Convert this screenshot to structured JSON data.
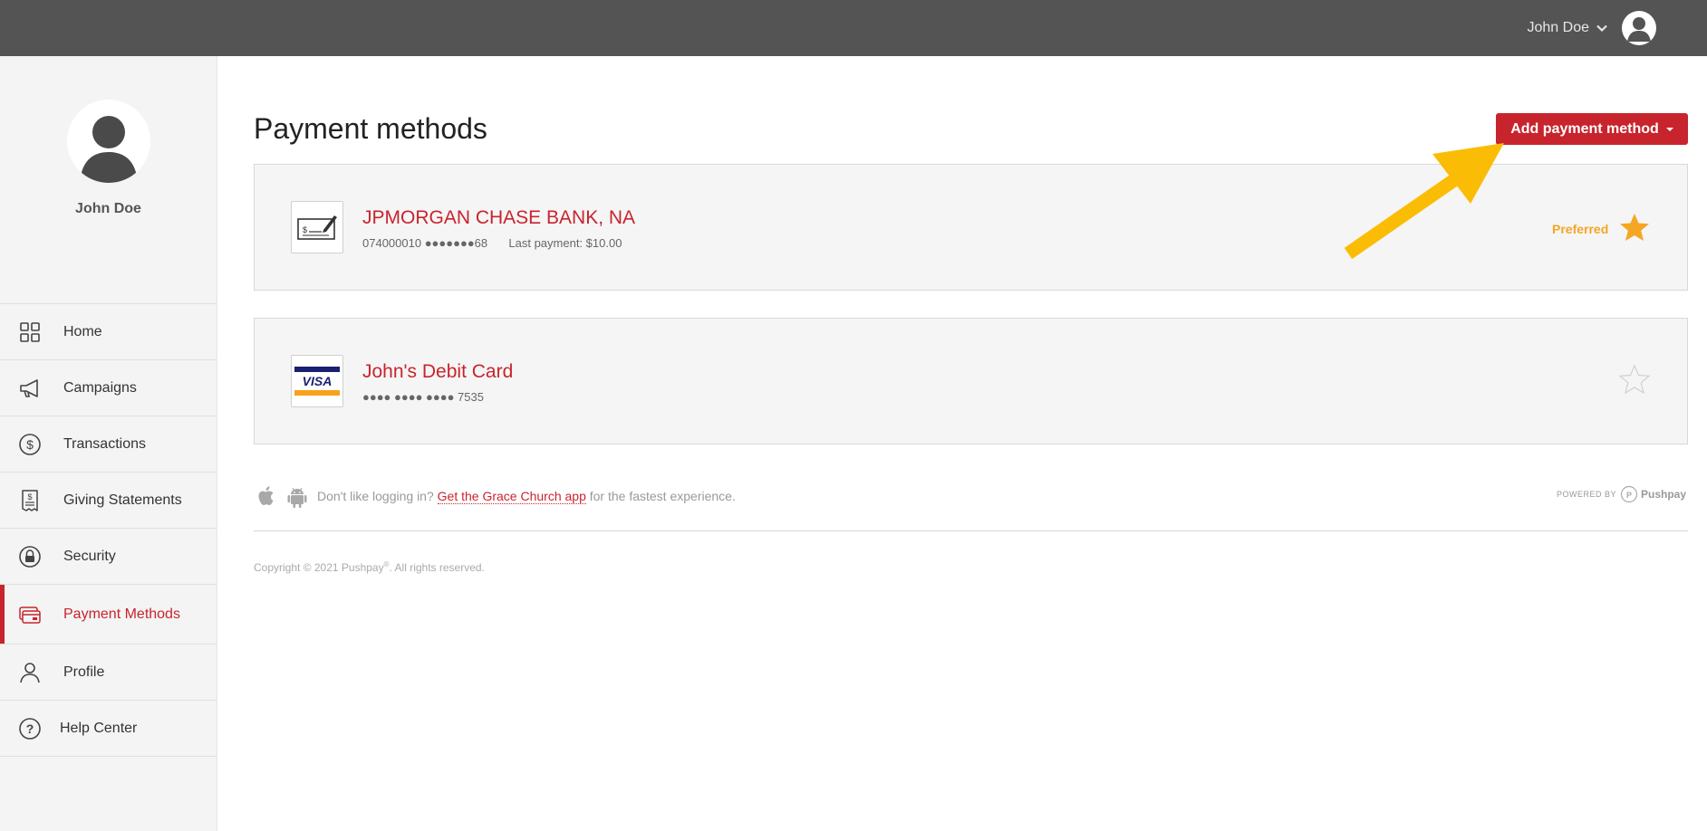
{
  "header": {
    "user_name": "John Doe",
    "icons": {
      "dropdown": "chevron-down-icon",
      "avatar": "user-avatar-icon"
    }
  },
  "sidebar": {
    "profile_name": "John Doe",
    "items": [
      {
        "id": "home",
        "label": "Home",
        "icon": "grid-icon",
        "active": false
      },
      {
        "id": "campaigns",
        "label": "Campaigns",
        "icon": "megaphone-icon",
        "active": false
      },
      {
        "id": "transactions",
        "label": "Transactions",
        "icon": "dollar-circle-icon",
        "active": false
      },
      {
        "id": "giving-statements",
        "label": "Giving Statements",
        "icon": "receipt-icon",
        "active": false
      },
      {
        "id": "security",
        "label": "Security",
        "icon": "lock-icon",
        "active": false
      },
      {
        "id": "payment-methods",
        "label": "Payment Methods",
        "icon": "credit-cards-icon",
        "active": true
      },
      {
        "id": "profile",
        "label": "Profile",
        "icon": "person-icon",
        "active": false
      },
      {
        "id": "help-center",
        "label": "Help Center",
        "icon": "question-circle-icon",
        "active": false
      }
    ]
  },
  "main": {
    "title": "Payment methods",
    "add_button_label": "Add payment method",
    "payment_methods": [
      {
        "name": "JPMORGAN CHASE BANK, NA",
        "type_icon": "check-icon",
        "routing": "074000010",
        "account_masked": "●●●●●●●68",
        "last_payment": "Last payment: $10.00",
        "preferred_label": "Preferred",
        "preferred": true
      },
      {
        "name": "John's Debit Card",
        "type_icon": "visa-card-icon",
        "brand_text": "VISA",
        "card_masked": "●●●● ●●●● ●●●● 7535",
        "preferred": false
      }
    ]
  },
  "footer": {
    "prefix": "Don't like logging in?",
    "link": "Get the Grace Church app",
    "suffix": "for the fastest experience.",
    "powered_by": "POWERED BY",
    "brand": "Pushpay",
    "copyright_prefix": "Copyright © 2021 Pushpay",
    "copyright_reg": "®",
    "copyright_suffix": ". All rights reserved."
  },
  "colors": {
    "accent": "#c8242d",
    "topbar": "#545454",
    "preferred": "#f5a623",
    "annotation_arrow": "#fbbc05"
  }
}
